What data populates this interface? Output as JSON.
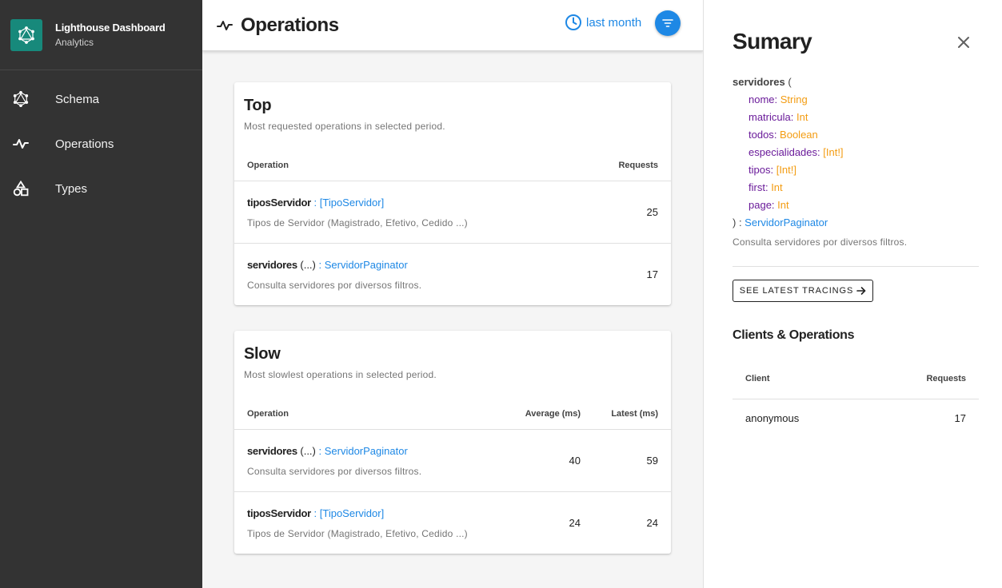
{
  "brand": {
    "title": "Lighthouse Dashboard",
    "subtitle": "Analytics"
  },
  "nav": [
    {
      "label": "Schema",
      "icon": "graphql-icon"
    },
    {
      "label": "Operations",
      "icon": "pulse-icon"
    },
    {
      "label": "Types",
      "icon": "shapes-icon"
    }
  ],
  "header": {
    "title": "Operations",
    "period": "last month",
    "icons": [
      "pulse-icon",
      "clock-icon",
      "filter-icon"
    ]
  },
  "top": {
    "title": "Top",
    "subtitle": "Most requested operations in selected period.",
    "columns": {
      "operation": "Operation",
      "requests": "Requests"
    },
    "rows": [
      {
        "name": "tiposServidor",
        "args": "",
        "sep": " : ",
        "type": "[TipoServidor]",
        "desc": "Tipos de Servidor (Magistrado, Efetivo, Cedido ...)",
        "requests": "25"
      },
      {
        "name": "servidores",
        "args": " (...)",
        "sep": " : ",
        "type": "ServidorPaginator",
        "desc": "Consulta servidores por diversos filtros.",
        "requests": "17"
      }
    ]
  },
  "slow": {
    "title": "Slow",
    "subtitle": "Most slowlest operations in selected period.",
    "columns": {
      "operation": "Operation",
      "average": "Average (ms)",
      "latest": "Latest (ms)"
    },
    "rows": [
      {
        "name": "servidores",
        "args": " (...)",
        "sep": " : ",
        "type": "ServidorPaginator",
        "desc": "Consulta servidores por diversos filtros.",
        "average": "40",
        "latest": "59"
      },
      {
        "name": "tiposServidor",
        "args": "",
        "sep": " : ",
        "type": "[TipoServidor]",
        "desc": "Tipos de Servidor (Magistrado, Efetivo, Cedido ...)",
        "average": "24",
        "latest": "24"
      }
    ]
  },
  "summary": {
    "title": "Sumary",
    "field": "servidores",
    "open": " (",
    "args": [
      {
        "name": "nome",
        "type": "String"
      },
      {
        "name": "matricula",
        "type": "Int"
      },
      {
        "name": "todos",
        "type": "Boolean"
      },
      {
        "name": "especialidades",
        "type": "[Int!]"
      },
      {
        "name": "tipos",
        "type": "[Int!]"
      },
      {
        "name": "first",
        "type": "Int"
      },
      {
        "name": "page",
        "type": "Int"
      }
    ],
    "close": ") : ",
    "return_type": "ServidorPaginator",
    "description": "Consulta servidores por diversos filtros.",
    "trace_button": "SEE LATEST TRACINGS",
    "clients_title": "Clients & Operations",
    "clients_columns": {
      "client": "Client",
      "requests": "Requests"
    },
    "clients": [
      {
        "client": "anonymous",
        "requests": "17"
      }
    ]
  },
  "colors": {
    "sidebar": "#333333",
    "brand": "#17897b",
    "accent": "#1e88e5",
    "arg_name": "#6a1b9a",
    "arg_type": "#f39c12"
  }
}
